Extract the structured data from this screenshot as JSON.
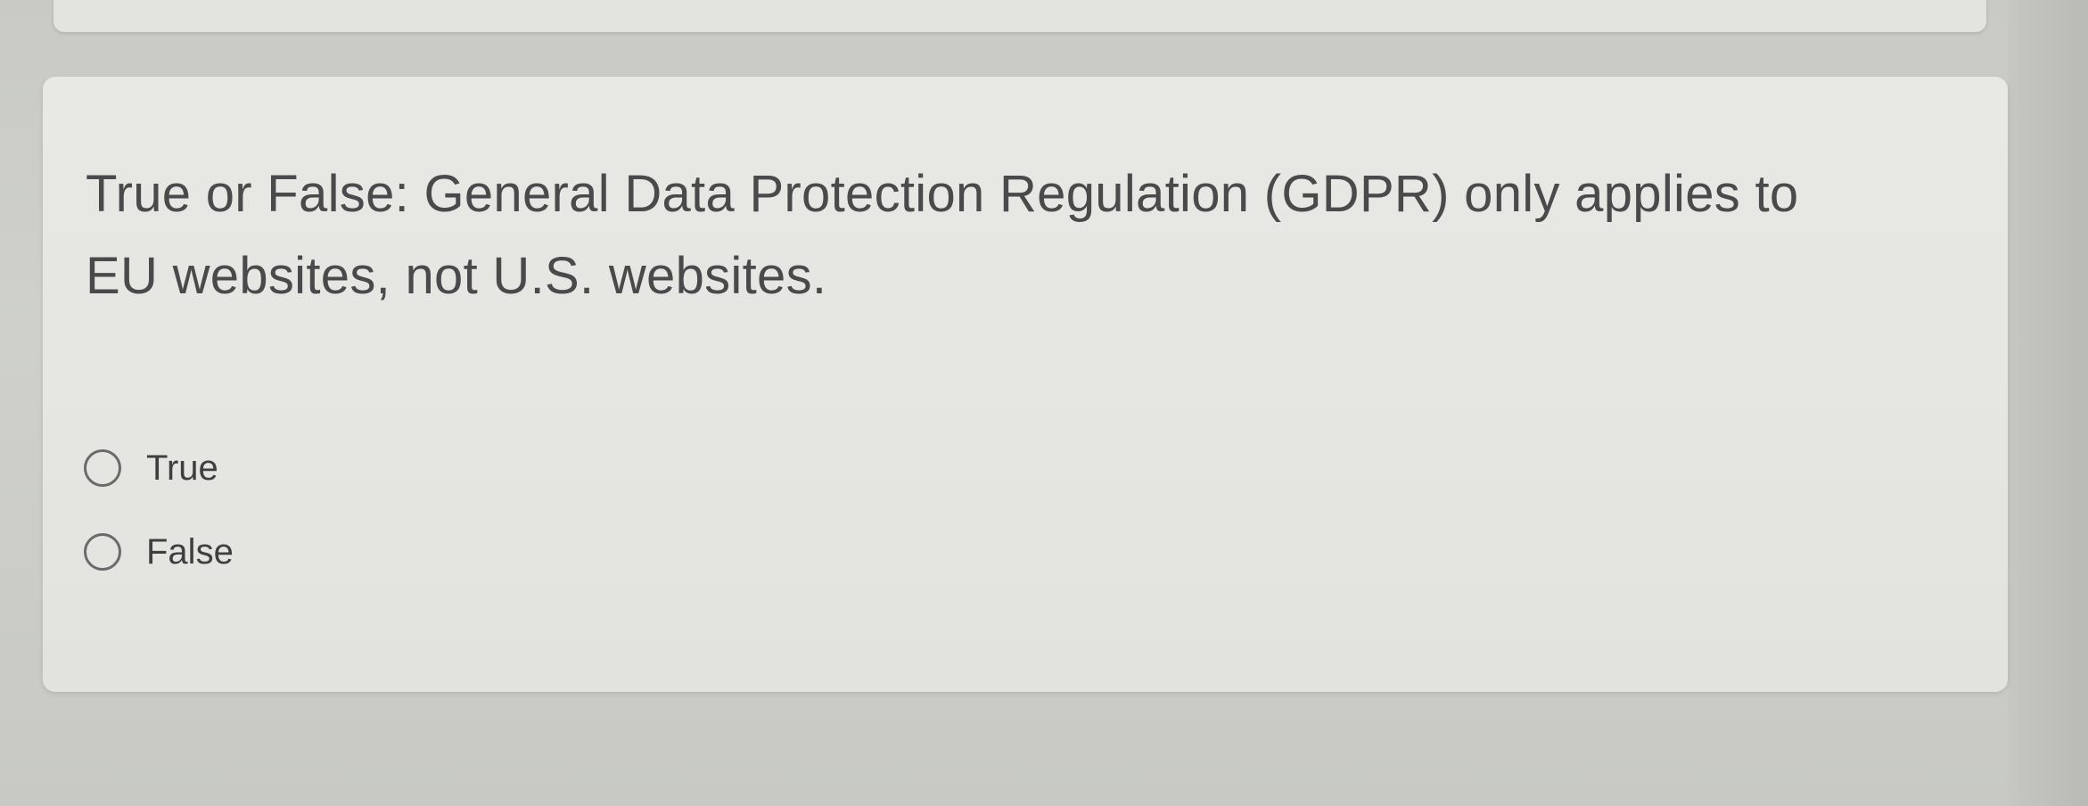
{
  "question": {
    "text": "True or False: General Data Protection Regulation (GDPR) only applies to EU websites, not U.S. websites.",
    "options": [
      {
        "label": "True",
        "selected": false
      },
      {
        "label": "False",
        "selected": false
      }
    ]
  },
  "colors": {
    "background": "#cfd0cb",
    "card": "#e6e6e2",
    "text": "#4a4a4c",
    "radio_border": "#6a6a6c"
  }
}
